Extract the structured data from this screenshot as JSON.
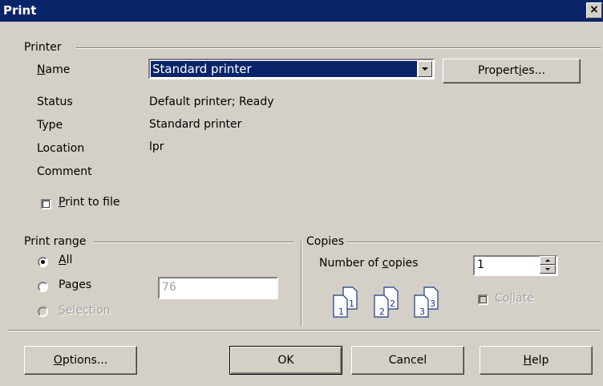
{
  "window": {
    "title": "Print",
    "close_glyph": "×"
  },
  "printer": {
    "group_label": "Printer",
    "name_label": "Name",
    "name_value": "Standard printer",
    "properties_button": "Properties...",
    "status_label": "Status",
    "status_value": "Default printer; Ready",
    "type_label": "Type",
    "type_value": "Standard printer",
    "location_label": "Location",
    "location_value": "lpr",
    "comment_label": "Comment",
    "comment_value": "",
    "print_to_file_label": "Print to file",
    "print_to_file_checked": false
  },
  "print_range": {
    "group_label": "Print range",
    "options": [
      {
        "label": "All",
        "checked": true,
        "enabled": true
      },
      {
        "label": "Pages",
        "checked": false,
        "enabled": true
      },
      {
        "label": "Selection",
        "checked": false,
        "enabled": false
      }
    ],
    "pages_value": "76"
  },
  "copies": {
    "group_label": "Copies",
    "number_label": "Number of copies",
    "number_value": "1",
    "collate_label": "Collate",
    "collate_checked": false,
    "collate_enabled": false,
    "sample_pages": [
      "1",
      "1",
      "2",
      "2",
      "3",
      "3"
    ]
  },
  "buttons": {
    "options": "Options...",
    "ok": "OK",
    "cancel": "Cancel",
    "help": "Help"
  }
}
